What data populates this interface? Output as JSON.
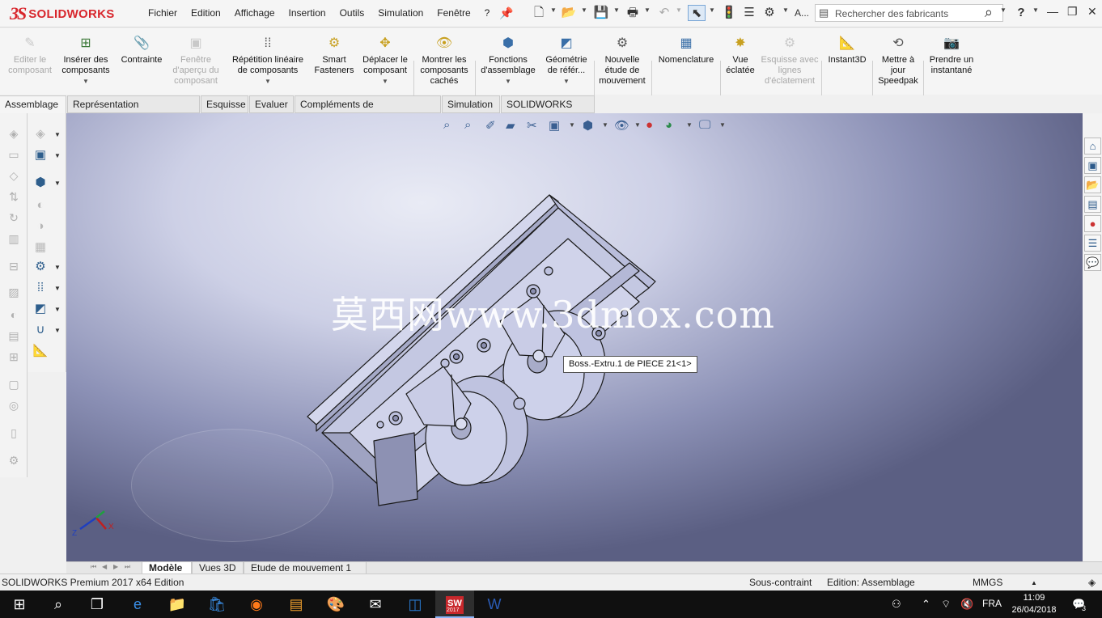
{
  "app": {
    "logo_ds": "3S",
    "logo_name": "SOLIDWORKS"
  },
  "menu": [
    "Fichier",
    "Edition",
    "Affichage",
    "Insertion",
    "Outils",
    "Simulation",
    "Fenêtre",
    "?"
  ],
  "quick_access": {
    "truncated_label": "A...",
    "search_placeholder": "Rechercher des fabricants",
    "help_label": "?"
  },
  "commands": [
    {
      "label": "Editer le composant",
      "enabled": false,
      "icon": "edit-component-icon",
      "dropdown": false
    },
    {
      "label": "Insérer des composants",
      "enabled": true,
      "icon": "insert-components-icon",
      "dropdown": true
    },
    {
      "label": "Contrainte",
      "enabled": true,
      "icon": "mate-paperclip-icon",
      "dropdown": false
    },
    {
      "label": "Fenêtre d'aperçu du composant",
      "enabled": false,
      "icon": "component-preview-icon",
      "dropdown": false
    },
    {
      "label": "Répétition linéaire de composants",
      "enabled": true,
      "icon": "linear-pattern-icon",
      "dropdown": true
    },
    {
      "label": "Smart Fasteners",
      "enabled": true,
      "icon": "smart-fasteners-icon",
      "dropdown": false
    },
    {
      "label": "Déplacer le composant",
      "enabled": true,
      "icon": "move-component-icon",
      "dropdown": true
    },
    {
      "label": "Montrer les composants cachés",
      "enabled": true,
      "icon": "show-hidden-icon",
      "dropdown": false
    },
    {
      "label": "Fonctions d'assemblage",
      "enabled": true,
      "icon": "assembly-features-icon",
      "dropdown": true
    },
    {
      "label": "Géométrie de référ...",
      "enabled": true,
      "icon": "reference-geometry-icon",
      "dropdown": true
    },
    {
      "label": "Nouvelle étude de mouvement",
      "enabled": true,
      "icon": "motion-study-icon",
      "dropdown": false
    },
    {
      "label": "Nomenclature",
      "enabled": true,
      "icon": "bom-icon",
      "dropdown": false
    },
    {
      "label": "Vue éclatée",
      "enabled": true,
      "icon": "exploded-view-icon",
      "dropdown": false
    },
    {
      "label": "Esquisse avec lignes d'éclatement",
      "enabled": false,
      "icon": "explode-line-sketch-icon",
      "dropdown": false
    },
    {
      "label": "Instant3D",
      "enabled": true,
      "icon": "instant3d-icon",
      "dropdown": false
    },
    {
      "label": "Mettre à jour Speedpak",
      "enabled": true,
      "icon": "speedpak-icon",
      "dropdown": false
    },
    {
      "label": "Prendre un instantané",
      "enabled": true,
      "icon": "camera-icon",
      "dropdown": false
    }
  ],
  "tabs": [
    "Assemblage",
    "Représentation schématique",
    "Esquisse",
    "Evaluer",
    "Compléments de SOLIDWORKS",
    "Simulation",
    "SOLIDWORKS MBD"
  ],
  "active_tab": "Assemblage",
  "viewport": {
    "watermark": "莫西网www.3dmox.com",
    "tooltip": "Boss.-Extru.1 de PIECE 21<1>",
    "triad_z": "Z",
    "triad_x": "X"
  },
  "bottom_tabs": [
    "Modèle",
    "Vues 3D",
    "Etude de mouvement 1"
  ],
  "active_bottom_tab": "Modèle",
  "status": {
    "product": "SOLIDWORKS Premium 2017 x64 Edition",
    "constraint": "Sous-contraint",
    "edit_mode": "Edition: Assemblage",
    "units": "MMGS"
  },
  "taskbar": {
    "language": "FRA",
    "time": "11:09",
    "date": "26/04/2018",
    "notifications": "3",
    "sw_label": "SW",
    "sw_year": "2017"
  },
  "colors": {
    "brand_red": "#d8262c",
    "toolbar_bg": "#f5f5f5",
    "viewport_light": "#e9ebf5",
    "viewport_dark": "#5b5f83",
    "taskbar_bg": "#101010",
    "part_fill": "#c7cbe6"
  }
}
